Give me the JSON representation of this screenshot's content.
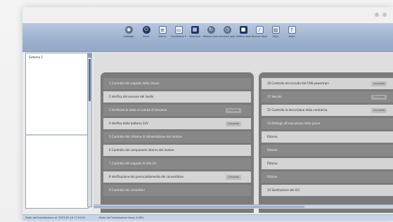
{
  "toolbar": {
    "buttons": [
      {
        "label": "Catalogo",
        "icon": "tag-icon"
      },
      {
        "label": "Avvio",
        "icon": "power-icon"
      },
      {
        "label": "Elenco",
        "icon": "list-icon"
      },
      {
        "label": "Condizione iniziale",
        "icon": "monitor-icon"
      },
      {
        "label": "Selezione",
        "icon": "grid-icon"
      },
      {
        "label": "Riavvio manuale",
        "icon": "reset-icon"
      },
      {
        "label": "Accesso rapido",
        "icon": "clock-icon"
      },
      {
        "label": "Cattura rapida",
        "icon": "camera-icon"
      },
      {
        "label": "Ricerca dispositivi",
        "icon": "wand-icon"
      },
      {
        "label": "Filtro",
        "icon": "filter-icon"
      },
      {
        "label": "Aiuto",
        "icon": "help-icon"
      }
    ]
  },
  "tree": {
    "items": [
      "Sistema 1"
    ]
  },
  "left_panel": {
    "rows": [
      {
        "text": "1 Controllo del segnale della chiave",
        "style": "dark",
        "pill": ""
      },
      {
        "text": "2 Verifica del sensore del livello",
        "style": "light",
        "pill": ""
      },
      {
        "text": "3 Verificare lo stato di caduta di tensione",
        "style": "dark",
        "pill": "Completo"
      },
      {
        "text": "4 Verifica della batteria 12V",
        "style": "light",
        "pill": "Completo"
      },
      {
        "text": "5 Controllo del sistema di alimentazione del motore",
        "style": "dark",
        "pill": ""
      },
      {
        "text": "6 Controllo dei componenti interno del motore",
        "style": "light",
        "pill": ""
      },
      {
        "text": "7 Controllo del segnale di rete CA",
        "style": "dark",
        "pill": ""
      },
      {
        "text": "8 Verificazione del preriscaldamento del convertitore",
        "style": "light",
        "pill": "Completo"
      },
      {
        "text": "9 Controllo dei connettori",
        "style": "dark",
        "pill": ""
      }
    ]
  },
  "right_panel": {
    "rows": [
      {
        "text": "10 Controllo del circuito del CAN powertrain",
        "style": "light",
        "pill": "Completo"
      },
      {
        "text": "11 Veicolo",
        "style": "dark",
        "pill": "Completo"
      },
      {
        "text": "12 Controllo la descrizione della centralina",
        "style": "light",
        "pill": "Completo"
      },
      {
        "text": "13 Dettagli all'esecuzione delle prove",
        "style": "dark",
        "pill": ""
      },
      {
        "text": "Ritorno",
        "style": "light",
        "pill": ""
      },
      {
        "text": "Ritorno",
        "style": "dark",
        "pill": ""
      },
      {
        "text": "Ritorno",
        "style": "light",
        "pill": ""
      },
      {
        "text": "Ritorno",
        "style": "dark",
        "pill": ""
      },
      {
        "text": "14 Sostituzione del UCI",
        "style": "light",
        "pill": ""
      }
    ]
  },
  "status": {
    "left": "Stato dell'installazione al: 2023-05-16 17:34:52",
    "right": "Stato dell'installazione base: 6,58%"
  }
}
